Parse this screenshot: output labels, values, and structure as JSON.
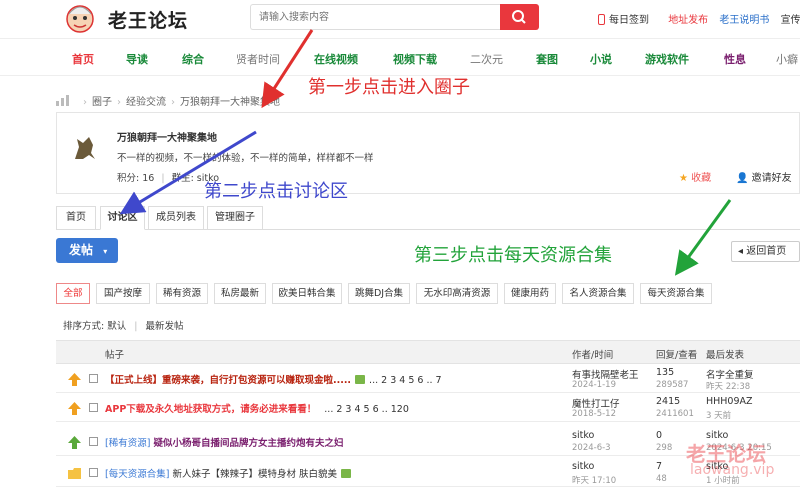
{
  "header": {
    "logo_text": "老王论坛",
    "search_placeholder": "请输入搜索内容",
    "checkin": "每日签到",
    "address_link": "地址发布",
    "manual_link": "老王说明书",
    "promo_link": "宣传中"
  },
  "nav": [
    "首页",
    "导读",
    "综合",
    "贤者时间",
    "在线视频",
    "视频下载",
    "二次元",
    "套图",
    "小说",
    "游戏软件",
    "性息",
    "小癖"
  ],
  "breadcrumb": [
    "圈子",
    "经验交流",
    "万狼朝拜一大神聚集地"
  ],
  "group": {
    "title": "万狼朝拜一大神聚集地",
    "desc": "不一样的视频，不一样的体验，不一样的简单，样样都不一样",
    "score_label": "积分: 16",
    "owner_label": "群主: sitko",
    "fav": "收藏",
    "invite": "邀请好友"
  },
  "tabs": [
    "首页",
    "讨论区",
    "成员列表",
    "管理圈子"
  ],
  "post_button": "发帖",
  "back_button": "返回首页",
  "categories": [
    "全部",
    "国产按摩",
    "稀有资源",
    "私房最新",
    "欧美日韩合集",
    "跳舞DJ合集",
    "无水印高清资源",
    "健康用药",
    "名人资源合集",
    "每天资源合集"
  ],
  "sort": {
    "label": "排序方式:",
    "default": "默认",
    "latest": "最新发帖"
  },
  "table": {
    "headers": {
      "topic": "帖子",
      "author": "作者/时间",
      "stats": "回复/查看",
      "last": "最后发表"
    },
    "rows": [
      {
        "title": "【正式上线】重磅来袭，自行打包资源可以赚取现金啦.....",
        "pages": "... 2 3 4 5 6 .. 7",
        "author": "有事找隔壁老王",
        "date": "2024-1-19",
        "replies": "135",
        "views": "289587",
        "last": "名字全重复",
        "last_date": "昨天 22:38"
      },
      {
        "title": "APP下载及永久地址获取方式，请务必进来看看！",
        "pages": "... 2 3 4 5 6 .. 120",
        "author": "魔性打工仔",
        "date": "2018-5-12",
        "replies": "2415",
        "views": "2411601",
        "last": "HHH09AZ",
        "last_date": "3 天前"
      },
      {
        "title_prefix": "[稀有资源]",
        "title": "疑似小杨哥自播间品牌方女主播约炮有夫之妇",
        "author": "sitko",
        "date": "2024-6-3",
        "replies": "0",
        "views": "298",
        "last": "sitko",
        "last_date": "2024-6-3 20:15"
      },
      {
        "title_prefix": "[每天资源合集]",
        "title": "新人妹子【辣辣子】模特身材 肤白貌美",
        "author": "sitko",
        "date": "昨天 17:10",
        "replies": "7",
        "views": "48",
        "last": "sitko",
        "last_date": "1 小时前"
      }
    ]
  },
  "annotations": {
    "step1": "第一步点击进入圈子",
    "step2": "第二步点击讨论区",
    "step3": "第三步点击每天资源合集"
  },
  "watermark": {
    "text": "老王论坛",
    "domain": "laowang.vip"
  },
  "colors": {
    "red": "#e9373d",
    "nav_green": "#1a8a3a",
    "blue_button": "#3a78d4",
    "annotation_red": "#e0302e",
    "annotation_blue": "#3f48cc",
    "annotation_green": "#22a33a"
  }
}
